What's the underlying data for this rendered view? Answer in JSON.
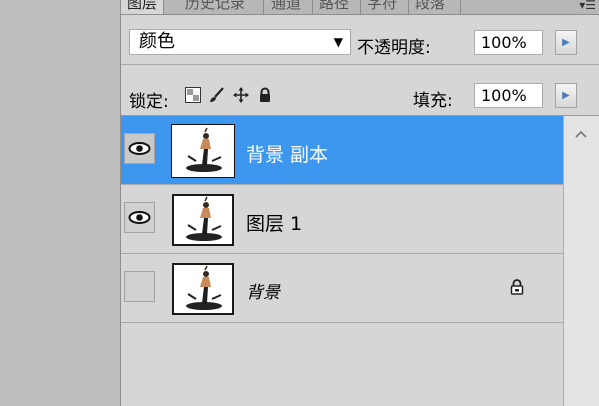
{
  "tabs": [
    {
      "label": "图层",
      "active": true
    },
    {
      "label": "历史记录",
      "active": false
    },
    {
      "label": "通道",
      "active": false
    },
    {
      "label": "路径",
      "active": false
    },
    {
      "label": "字符",
      "active": false
    },
    {
      "label": "段落",
      "active": false
    }
  ],
  "blend_mode": {
    "value": "颜色"
  },
  "opacity": {
    "label": "不透明度:",
    "value": "100%"
  },
  "lock": {
    "label": "锁定:",
    "icons": [
      "lock-transparent-icon",
      "lock-paint-icon",
      "lock-move-icon",
      "lock-all-icon"
    ]
  },
  "fill": {
    "label": "填充:",
    "value": "100%"
  },
  "layers": [
    {
      "name": "背景 副本",
      "selected": true,
      "visible": true,
      "locked": false
    },
    {
      "name": "图层 1",
      "selected": false,
      "visible": true,
      "locked": false
    },
    {
      "name": "背景",
      "selected": false,
      "visible": false,
      "locked": true
    }
  ],
  "colors": {
    "selection": "#3d97ee",
    "panel": "#d6d6d6"
  }
}
